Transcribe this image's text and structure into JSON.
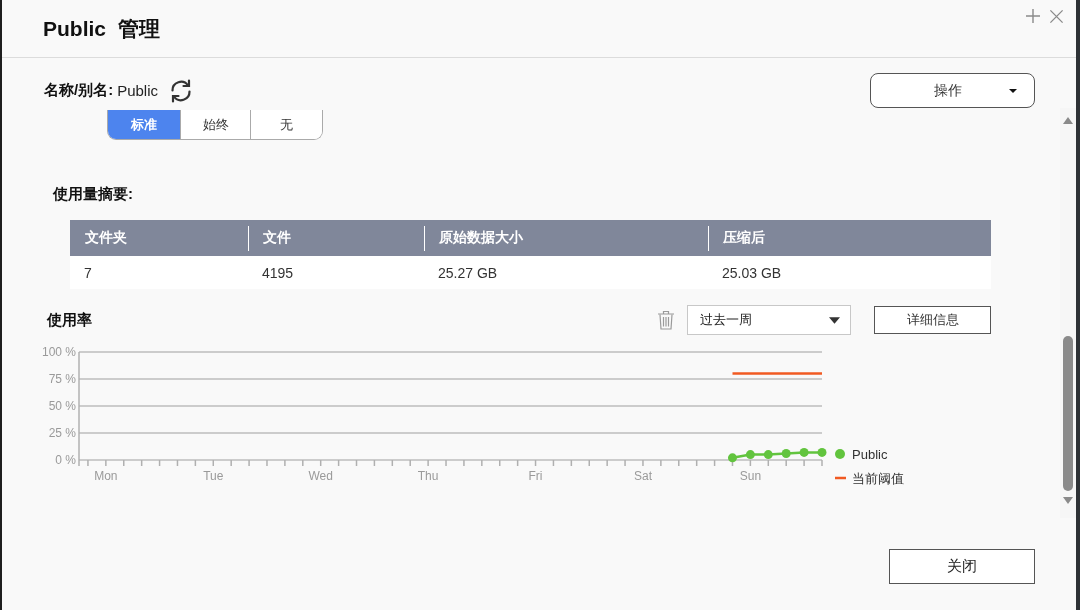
{
  "window": {
    "title": "Public 管理"
  },
  "name_row": {
    "label": "名称/别名:",
    "value": "Public"
  },
  "actions_menu": {
    "label": "操作"
  },
  "mode_tabs": [
    {
      "label": "标准",
      "selected": true
    },
    {
      "label": "始终",
      "selected": false
    },
    {
      "label": "无",
      "selected": false
    }
  ],
  "usage_summary": {
    "title": "使用量摘要:",
    "columns": [
      "文件夹",
      "文件",
      "原始数据大小",
      "压缩后"
    ],
    "rows": [
      [
        "7",
        "4195",
        "25.27 GB",
        "25.03 GB"
      ]
    ]
  },
  "usage_rate": {
    "title": "使用率",
    "period_select": {
      "value": "过去一周"
    },
    "details_button": "详细信息",
    "chart_data": [
      {
        "type": "line",
        "categories": [
          null,
          "Mon",
          null,
          null,
          null,
          null,
          null,
          "Tue",
          null,
          null,
          null,
          null,
          null,
          "Wed",
          null,
          null,
          null,
          null,
          null,
          "Thu",
          null,
          null,
          null,
          null,
          null,
          "Fri",
          null,
          null,
          null,
          null,
          null,
          "Sat",
          null,
          null,
          null,
          null,
          null,
          "Sun",
          null,
          null,
          null,
          null
        ],
        "ylim": [
          0,
          100
        ],
        "yticks": [
          {
            "value": 0,
            "label": "0 %"
          },
          {
            "value": 25,
            "label": "25 %"
          },
          {
            "value": 50,
            "label": "50 %"
          },
          {
            "value": 75,
            "label": "75 %"
          },
          {
            "value": 100,
            "label": "100 %"
          }
        ],
        "grid": true,
        "legend": "right",
        "series": [
          {
            "name": "Public",
            "color": "#62c43e",
            "marker": "circle",
            "values": [
              null,
              null,
              null,
              null,
              null,
              null,
              null,
              null,
              null,
              null,
              null,
              null,
              null,
              null,
              null,
              null,
              null,
              null,
              null,
              null,
              null,
              null,
              null,
              null,
              null,
              null,
              null,
              null,
              null,
              null,
              null,
              null,
              null,
              null,
              null,
              null,
              2,
              5,
              5,
              6,
              7,
              7
            ]
          },
          {
            "name": "当前阈值",
            "color": "#f15a22",
            "values": [
              null,
              null,
              null,
              null,
              null,
              null,
              null,
              null,
              null,
              null,
              null,
              null,
              null,
              null,
              null,
              null,
              null,
              null,
              null,
              null,
              null,
              null,
              null,
              null,
              null,
              null,
              null,
              null,
              null,
              null,
              null,
              null,
              null,
              null,
              null,
              null,
              80,
              80,
              80,
              80,
              80,
              80
            ]
          }
        ]
      }
    ]
  },
  "footer": {
    "close_button": "关闭"
  }
}
